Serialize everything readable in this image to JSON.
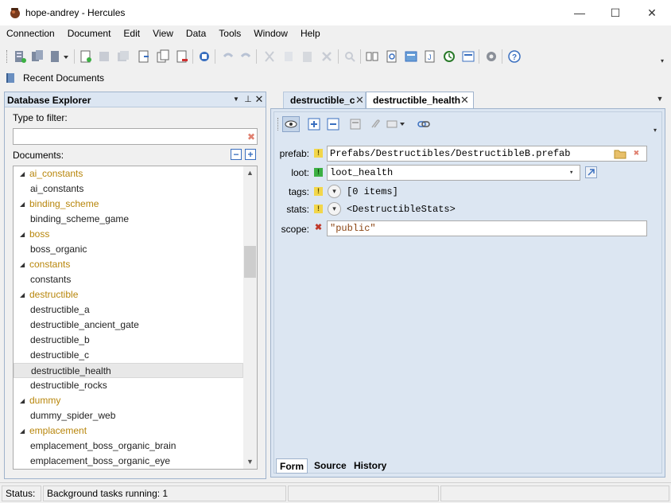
{
  "window": {
    "title": "hope-andrey - Hercules",
    "minimize_glyph": "—",
    "maximize_glyph": "☐",
    "close_glyph": "✕"
  },
  "menu": [
    "Connection",
    "Document",
    "Edit",
    "View",
    "Data",
    "Tools",
    "Window",
    "Help"
  ],
  "recent": {
    "label": "Recent Documents"
  },
  "explorer": {
    "title": "Database Explorer",
    "filter_label": "Type to filter:",
    "filter_value": "",
    "documents_label": "Documents:",
    "tree": [
      {
        "type": "category",
        "label": "ai_constants"
      },
      {
        "type": "leaf",
        "label": "ai_constants"
      },
      {
        "type": "category",
        "label": "binding_scheme"
      },
      {
        "type": "leaf",
        "label": "binding_scheme_game"
      },
      {
        "type": "category",
        "label": "boss"
      },
      {
        "type": "leaf",
        "label": "boss_organic"
      },
      {
        "type": "category",
        "label": "constants"
      },
      {
        "type": "leaf",
        "label": "constants"
      },
      {
        "type": "category",
        "label": "destructible"
      },
      {
        "type": "leaf",
        "label": "destructible_a"
      },
      {
        "type": "leaf",
        "label": "destructible_ancient_gate"
      },
      {
        "type": "leaf",
        "label": "destructible_b"
      },
      {
        "type": "leaf",
        "label": "destructible_c"
      },
      {
        "type": "leaf",
        "label": "destructible_health",
        "selected": true
      },
      {
        "type": "leaf",
        "label": "destructible_rocks"
      },
      {
        "type": "category",
        "label": "dummy"
      },
      {
        "type": "leaf",
        "label": "dummy_spider_web"
      },
      {
        "type": "category",
        "label": "emplacement"
      },
      {
        "type": "leaf",
        "label": "emplacement_boss_organic_brain"
      },
      {
        "type": "leaf",
        "label": "emplacement_boss_organic_eye"
      }
    ]
  },
  "tabs": [
    {
      "label": "destructible_c",
      "active": false
    },
    {
      "label": "destructible_health",
      "active": true
    }
  ],
  "form": {
    "fields": {
      "prefab": {
        "label": "prefab:",
        "status": "!",
        "value": "Prefabs/Destructibles/DestructibleB.prefab"
      },
      "loot": {
        "label": "loot:",
        "status": "!",
        "value": "loot_health"
      },
      "tags": {
        "label": "tags:",
        "status": "!",
        "value": "[0 items]"
      },
      "stats": {
        "label": "stats:",
        "status": "!",
        "value": "<DestructibleStats>"
      },
      "scope": {
        "label": "scope:",
        "status": "✖",
        "value": "\"public\""
      }
    }
  },
  "bottom_tabs": [
    "Form",
    "Source",
    "History"
  ],
  "status": {
    "label": "Status:",
    "message": "Background tasks running: 1"
  },
  "colors": {
    "category_text": "#b8860b",
    "panel_header": "#dce6f2",
    "warning_badge": "#f2d64a",
    "ok_badge": "#3cb043",
    "error_mark": "#c0392b"
  }
}
